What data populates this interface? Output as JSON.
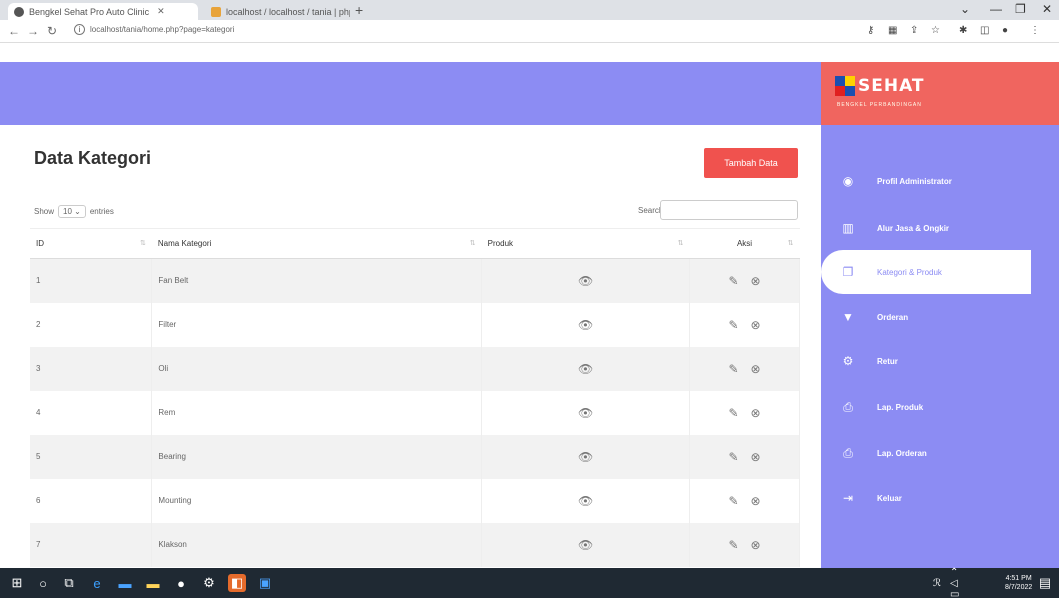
{
  "browser": {
    "tabs": [
      {
        "title": "Bengkel Sehat Pro Auto Clinic",
        "active": true
      },
      {
        "title": "localhost / localhost / tania | phpM",
        "active": false
      }
    ],
    "new_tab": "+",
    "url": "localhost/tania/home.php?page=kategori",
    "info_icon": "i"
  },
  "brand": {
    "name": "SEHAT",
    "tagline": "BENGKEL PERBANDINGAN"
  },
  "page": {
    "title": "Data Kategori",
    "add_button": "Tambah Data",
    "show_label": "Show",
    "show_value": "10",
    "entries_label": "entries",
    "search_label": "Search:"
  },
  "table": {
    "headers": [
      "ID",
      "Nama Kategori",
      "Produk",
      "Aksi"
    ],
    "rows": [
      {
        "id": "1",
        "name": "Fan Belt"
      },
      {
        "id": "2",
        "name": "Filter"
      },
      {
        "id": "3",
        "name": "Oli"
      },
      {
        "id": "4",
        "name": "Rem"
      },
      {
        "id": "5",
        "name": "Bearing"
      },
      {
        "id": "6",
        "name": "Mounting"
      },
      {
        "id": "7",
        "name": "Klakson"
      }
    ]
  },
  "sidebar": {
    "items": [
      {
        "label": "Profil Administrator",
        "icon": "user-circle-icon",
        "active": false
      },
      {
        "label": "Alur Jasa & Ongkir",
        "icon": "map-icon",
        "active": false
      },
      {
        "label": "Kategori & Produk",
        "icon": "copy-icon",
        "active": true
      },
      {
        "label": "Orderan",
        "icon": "cart-icon",
        "active": false
      },
      {
        "label": "Retur",
        "icon": "settings-icon",
        "active": false
      },
      {
        "label": "Lap. Produk",
        "icon": "print-icon",
        "active": false
      },
      {
        "label": "Lap. Orderan",
        "icon": "print-icon",
        "active": false
      },
      {
        "label": "Keluar",
        "icon": "logout-icon",
        "active": false
      }
    ]
  },
  "taskbar": {
    "time": "4:51 PM",
    "date": "8/7/2022"
  },
  "colors": {
    "header": "#8c8cf3",
    "brand": "#f0655f",
    "button": "#f0524e"
  }
}
